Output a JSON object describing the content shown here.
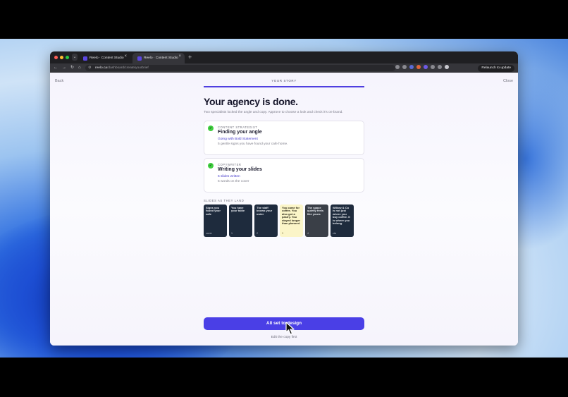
{
  "browser": {
    "tabs": [
      {
        "title": "Reelo · Content Studio",
        "active": false
      },
      {
        "title": "Reelo · Content Studio",
        "active": true
      }
    ],
    "url_host": "reelo.ca",
    "url_path": "/dashboard/create/yourbrief",
    "relaunch_label": "Relaunch to update",
    "traffic_lights": [
      "#ff5f57",
      "#febc2e",
      "#28c840"
    ]
  },
  "header": {
    "back_label": "Back",
    "close_label": "Close",
    "step_label": "YOUR STORY",
    "progress": 1.0
  },
  "main": {
    "title": "Your agency is done.",
    "subtitle": "Two specialists locked the angle and copy. Approve to choose a look and check it's on-brand.",
    "cards": [
      {
        "role": "CONTENT STRATEGIST",
        "title": "Finding your angle",
        "link": "Going with Bold Statement",
        "desc": "5 gentle signs you have found your cafe home."
      },
      {
        "role": "COPYWRITER",
        "title": "Writing your slides",
        "link": "6 slides written",
        "desc": "5 words on the cover"
      }
    ],
    "slides_label": "SLIDES AS THEY LAND",
    "slides": [
      {
        "text": "Signs you found your cafe",
        "num": "cover",
        "style": "dark"
      },
      {
        "text": "You have your table",
        "num": "1",
        "style": "dark"
      },
      {
        "text": "The staff knows your order",
        "num": "2",
        "style": "dark"
      },
      {
        "text": "You came for coffee. You also got a pastry. You stayed longer than planned.",
        "num": "3",
        "style": "cream"
      },
      {
        "text": "The space quietly feels like yours",
        "num": "4",
        "style": "dark"
      },
      {
        "text": "Willow & Co is not just where you buy coffee. It is where you belong.",
        "num": "cta",
        "style": "dark"
      }
    ]
  },
  "footer": {
    "cta_label": "All set to design",
    "edit_label": "Edit the copy first"
  }
}
